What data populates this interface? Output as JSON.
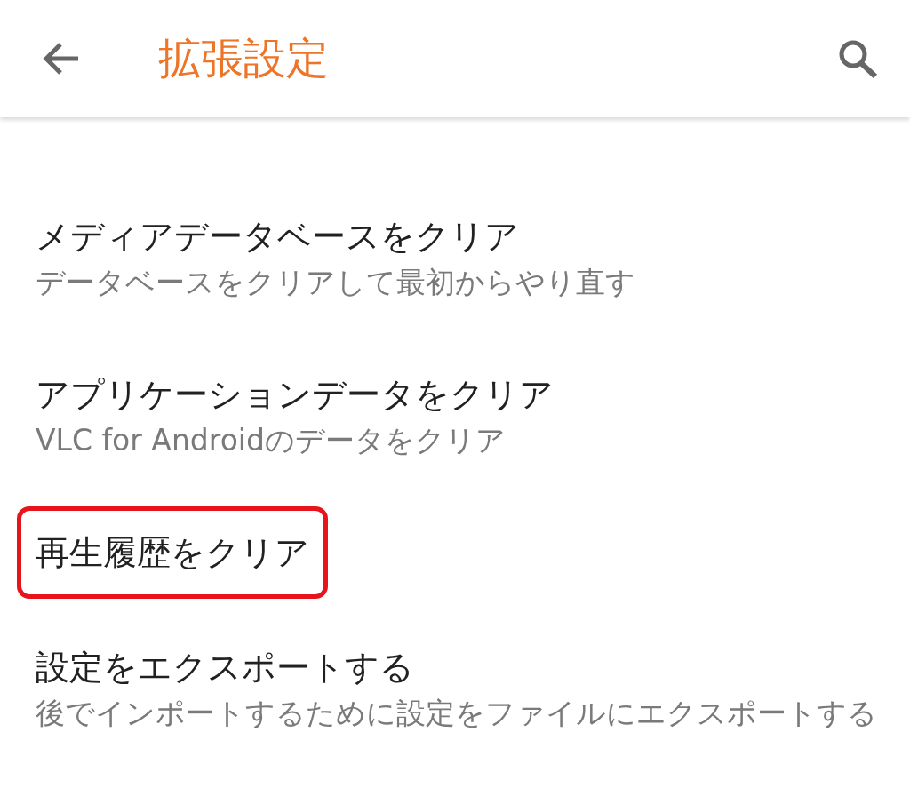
{
  "app_bar": {
    "title": "拡張設定"
  },
  "items": [
    {
      "title": "メディアデータベースをクリア",
      "subtitle": "データベースをクリアして最初からやり直す"
    },
    {
      "title": "アプリケーションデータをクリア",
      "subtitle": "VLC for Androidのデータをクリア"
    },
    {
      "title": "再生履歴をクリア",
      "highlighted": true
    },
    {
      "title": "設定をエクスポートする",
      "subtitle": "後でインポートするために設定をファイルにエクスポートする"
    }
  ]
}
